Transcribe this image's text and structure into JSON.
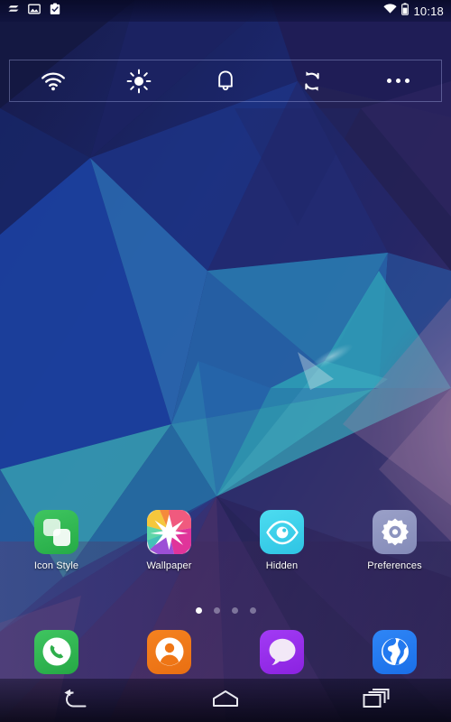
{
  "status_bar": {
    "left_icons": [
      {
        "name": "sync-lines-icon",
        "glyph": "sync-lines"
      },
      {
        "name": "image-icon",
        "glyph": "image"
      },
      {
        "name": "clipboard-check-icon",
        "glyph": "clipboard-check"
      }
    ],
    "right_icons": [
      {
        "name": "wifi-icon",
        "glyph": "wifi"
      },
      {
        "name": "battery-icon",
        "glyph": "battery"
      }
    ],
    "time": "10:18"
  },
  "quick_settings": {
    "buttons": [
      {
        "id": "wifi",
        "icon": "wifi-icon",
        "label": "Wi-Fi"
      },
      {
        "id": "brightness",
        "icon": "brightness-icon",
        "label": "Brightness"
      },
      {
        "id": "ringer",
        "icon": "bell-icon",
        "label": "Ringer"
      },
      {
        "id": "sync",
        "icon": "sync-icon",
        "label": "Sync"
      },
      {
        "id": "more",
        "icon": "overflow-menu-icon",
        "label": "More"
      }
    ]
  },
  "app_grid": {
    "apps": [
      {
        "id": "icon-style",
        "label": "Icon Style",
        "color": "#32b850"
      },
      {
        "id": "wallpaper",
        "label": "Wallpaper",
        "color": "#e8e2ea"
      },
      {
        "id": "hidden",
        "label": "Hidden",
        "color": "#39cee6"
      },
      {
        "id": "preferences",
        "label": "Preferences",
        "color": "#8d94bf"
      }
    ]
  },
  "page_indicator": {
    "total": 4,
    "active_index": 0
  },
  "dock": {
    "apps": [
      {
        "id": "phone",
        "label": "Phone",
        "color": "#32b850"
      },
      {
        "id": "contacts",
        "label": "Contacts",
        "color": "#ef7616"
      },
      {
        "id": "messages",
        "label": "Messages",
        "color": "#962ceb"
      },
      {
        "id": "browser",
        "label": "Browser",
        "color": "#2279ef"
      }
    ]
  },
  "nav_bar": {
    "buttons": [
      {
        "id": "back",
        "label": "Back"
      },
      {
        "id": "home",
        "label": "Home"
      },
      {
        "id": "recents",
        "label": "Recent apps"
      }
    ]
  },
  "wallpaper": {
    "style": "low-poly-geometric",
    "palette": [
      "#1b1f52",
      "#20348f",
      "#2b6fc4",
      "#35b6cf",
      "#4fd4d9",
      "#6a5fa8",
      "#b98fb5",
      "#c79bb8"
    ]
  }
}
